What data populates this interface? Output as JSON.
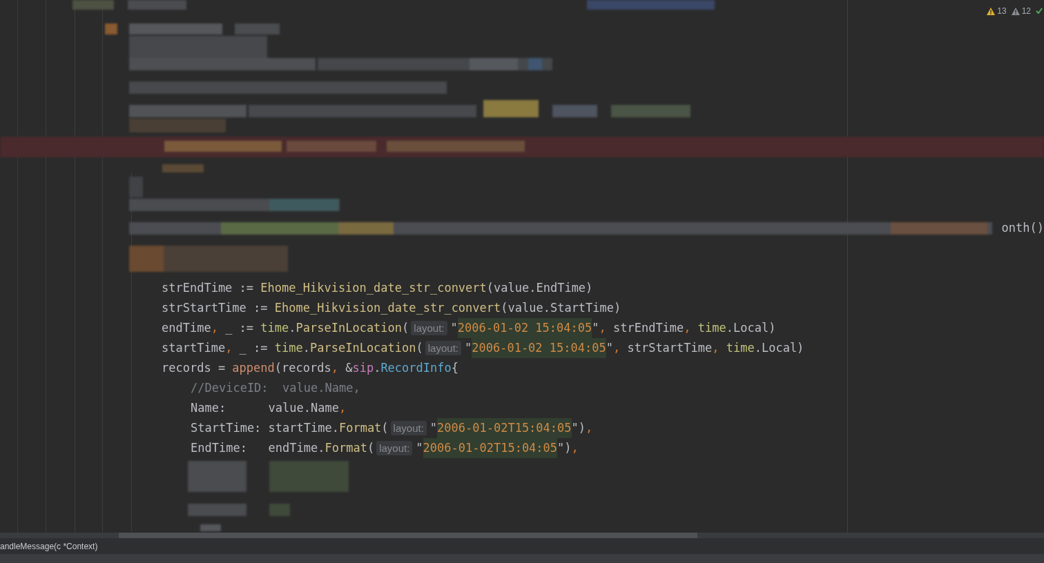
{
  "inspections": {
    "warnings": "13",
    "weak_warnings": "12",
    "passed": true
  },
  "partial_text": "onth()",
  "code_lines": [
    {
      "tokens": [
        {
          "t": "strEndTime := ",
          "kind": "plain"
        },
        {
          "t": "Ehome_Hikvision_date_str_convert",
          "kind": "func"
        },
        {
          "t": "(value.EndTime)",
          "kind": "plain"
        }
      ]
    },
    {
      "tokens": [
        {
          "t": "strStartTime := ",
          "kind": "plain"
        },
        {
          "t": "Ehome_Hikvision_date_str_convert",
          "kind": "func"
        },
        {
          "t": "(value.StartTime)",
          "kind": "plain"
        }
      ]
    },
    {
      "tokens": [
        {
          "t": "endTime",
          "kind": "plain"
        },
        {
          "t": ",",
          "kind": "punct"
        },
        {
          "t": " _ := ",
          "kind": "plain"
        },
        {
          "t": "time",
          "kind": "pkg"
        },
        {
          "t": ".",
          "kind": "plain"
        },
        {
          "t": "ParseInLocation",
          "kind": "func"
        },
        {
          "t": "(",
          "kind": "plain"
        },
        {
          "t": "layout:",
          "kind": "hint"
        },
        {
          "t": "\"",
          "kind": "plain"
        },
        {
          "t": "2006-01-02 15:04:05",
          "kind": "string"
        },
        {
          "t": "\"",
          "kind": "plain"
        },
        {
          "t": ",",
          "kind": "punct"
        },
        {
          "t": " strEndTime",
          "kind": "plain"
        },
        {
          "t": ", ",
          "kind": "punct"
        },
        {
          "t": "time",
          "kind": "pkg"
        },
        {
          "t": ".Local)",
          "kind": "plain"
        }
      ]
    },
    {
      "tokens": [
        {
          "t": "startTime",
          "kind": "plain"
        },
        {
          "t": ",",
          "kind": "punct"
        },
        {
          "t": " _ := ",
          "kind": "plain"
        },
        {
          "t": "time",
          "kind": "pkg"
        },
        {
          "t": ".",
          "kind": "plain"
        },
        {
          "t": "ParseInLocation",
          "kind": "func"
        },
        {
          "t": "(",
          "kind": "plain"
        },
        {
          "t": "layout:",
          "kind": "hint"
        },
        {
          "t": "\"",
          "kind": "plain"
        },
        {
          "t": "2006-01-02 15:04:05",
          "kind": "string"
        },
        {
          "t": "\"",
          "kind": "plain"
        },
        {
          "t": ",",
          "kind": "punct"
        },
        {
          "t": " strStartTime",
          "kind": "plain"
        },
        {
          "t": ", ",
          "kind": "punct"
        },
        {
          "t": "time",
          "kind": "pkg"
        },
        {
          "t": ".Local)",
          "kind": "plain"
        }
      ]
    },
    {
      "tokens": [
        {
          "t": "records = ",
          "kind": "plain"
        },
        {
          "t": "append",
          "kind": "builtin"
        },
        {
          "t": "(records",
          "kind": "plain"
        },
        {
          "t": ",",
          "kind": "punct"
        },
        {
          "t": " &",
          "kind": "plain"
        },
        {
          "t": "sip",
          "kind": "import"
        },
        {
          "t": ".",
          "kind": "plain"
        },
        {
          "t": "RecordInfo",
          "kind": "type"
        },
        {
          "t": "{",
          "kind": "plain"
        }
      ],
      "children": [
        {
          "tokens": [
            {
              "t": "//DeviceID:  value.Name,",
              "kind": "comment"
            }
          ]
        },
        {
          "tokens": [
            {
              "t": "Name:      value.Name",
              "kind": "plain"
            },
            {
              "t": ",",
              "kind": "punct"
            }
          ]
        },
        {
          "tokens": [
            {
              "t": "StartTime: startTime.",
              "kind": "plain"
            },
            {
              "t": "Format",
              "kind": "func"
            },
            {
              "t": "(",
              "kind": "plain"
            },
            {
              "t": "layout:",
              "kind": "hint"
            },
            {
              "t": "\"",
              "kind": "plain"
            },
            {
              "t": "2006-01-02T15:04:05",
              "kind": "string"
            },
            {
              "t": "\")",
              "kind": "plain"
            },
            {
              "t": ",",
              "kind": "punct"
            }
          ]
        },
        {
          "tokens": [
            {
              "t": "EndTime:   endTime.",
              "kind": "plain"
            },
            {
              "t": "Format",
              "kind": "func"
            },
            {
              "t": "(",
              "kind": "plain"
            },
            {
              "t": "layout:",
              "kind": "hint"
            },
            {
              "t": "\"",
              "kind": "plain"
            },
            {
              "t": "2006-01-02T15:04:05",
              "kind": "string"
            },
            {
              "t": "\")",
              "kind": "plain"
            },
            {
              "t": ",",
              "kind": "punct"
            }
          ]
        }
      ]
    }
  ],
  "status_bar": {
    "breadcrumb": "andleMessage(c *Context)"
  }
}
